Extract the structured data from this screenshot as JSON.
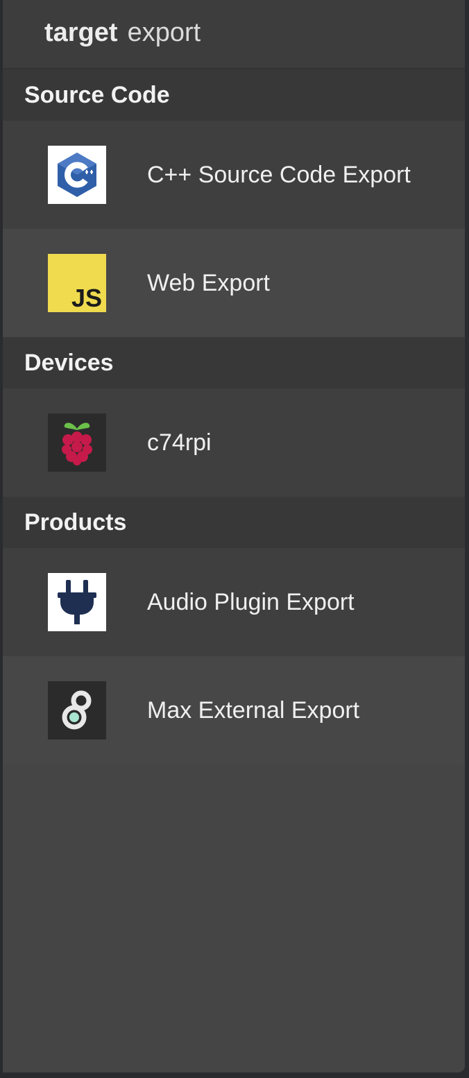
{
  "header": {
    "title_bold": "target",
    "title_light": "export"
  },
  "sections": [
    {
      "title": "Source Code",
      "items": [
        {
          "label": "C++ Source Code Export",
          "icon": "cpp-icon"
        },
        {
          "label": "Web Export",
          "icon": "javascript-icon",
          "icon_text": "JS"
        }
      ]
    },
    {
      "title": "Devices",
      "items": [
        {
          "label": "c74rpi",
          "icon": "raspberry-pi-icon"
        }
      ]
    },
    {
      "title": "Products",
      "items": [
        {
          "label": "Audio Plugin Export",
          "icon": "plug-icon"
        },
        {
          "label": "Max External Export",
          "icon": "max-external-icon"
        }
      ]
    }
  ],
  "colors": {
    "panel": "#454545",
    "section_header": "#383838",
    "js_yellow": "#f0db4f",
    "cpp_blue": "#2f5fa8",
    "raspberry_red": "#c51a4a",
    "plug_navy": "#1e2f52",
    "max_teal": "#a9e6d2"
  }
}
